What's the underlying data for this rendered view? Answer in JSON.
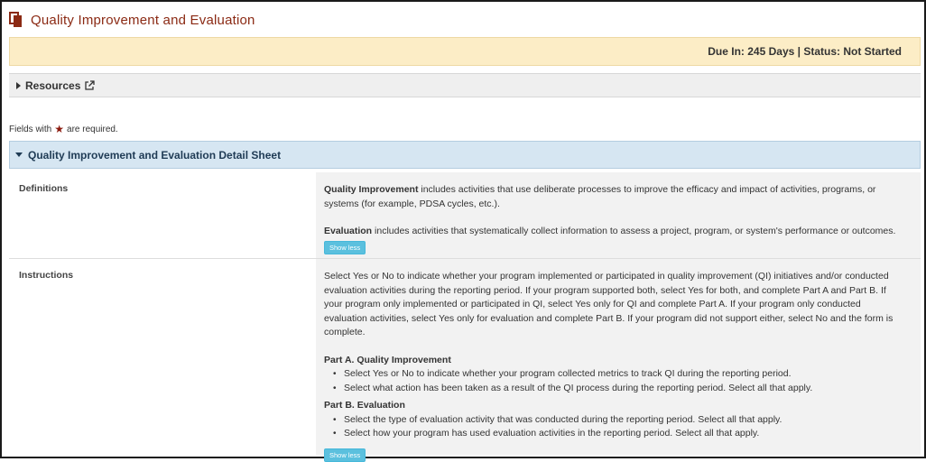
{
  "page": {
    "title": "Quality Improvement and Evaluation",
    "status_text": "Due In: 245 Days | Status: Not Started"
  },
  "resources": {
    "label": "Resources"
  },
  "required_note": {
    "prefix": "Fields with",
    "suffix": "are required."
  },
  "detail_sheet": {
    "title": "Quality Improvement and Evaluation Detail Sheet",
    "definitions": {
      "label": "Definitions",
      "qi_term": "Quality Improvement",
      "qi_text": " includes activities that use deliberate processes to improve the efficacy and impact of activities, programs, or systems (for example, PDSA cycles, etc.).",
      "eval_term": "Evaluation",
      "eval_text": " includes activities that systematically collect information to assess a project, program, or system's performance or outcomes.",
      "show_less": "Show less"
    },
    "instructions": {
      "label": "Instructions",
      "intro": "Select Yes or No to indicate whether your program implemented or participated in quality improvement (QI) initiatives and/or conducted evaluation activities during the reporting period. If your program supported both, select Yes for both, and complete Part A and Part B. If your program only implemented or participated in QI, select Yes only for QI and complete Part A. If your program only conducted evaluation activities, select Yes only for evaluation and complete Part B. If your program did not support either, select No and the form is complete.",
      "part_a": {
        "title": "Part A. Quality Improvement",
        "items": [
          "Select Yes or No to indicate whether your program collected metrics to track QI during the reporting period.",
          "Select what action has been taken as a result of the QI process during the reporting period. Select all that apply."
        ]
      },
      "part_b": {
        "title": "Part B. Evaluation",
        "items": [
          "Select the type of evaluation activity that was conducted during the reporting period. Select all that apply.",
          "Select how your program has used evaluation activities in the reporting period. Select all that apply."
        ]
      },
      "show_less": "Show less"
    }
  },
  "icons": {
    "title_icon": "document-icon",
    "external_link": "external-link-icon",
    "required": "star-icon"
  },
  "colors": {
    "title": "#8b2a14",
    "status_bg": "#fcedc6",
    "detail_header_bg": "#d6e6f2",
    "button": "#5bc0de",
    "required_star": "#8b1a0e"
  }
}
